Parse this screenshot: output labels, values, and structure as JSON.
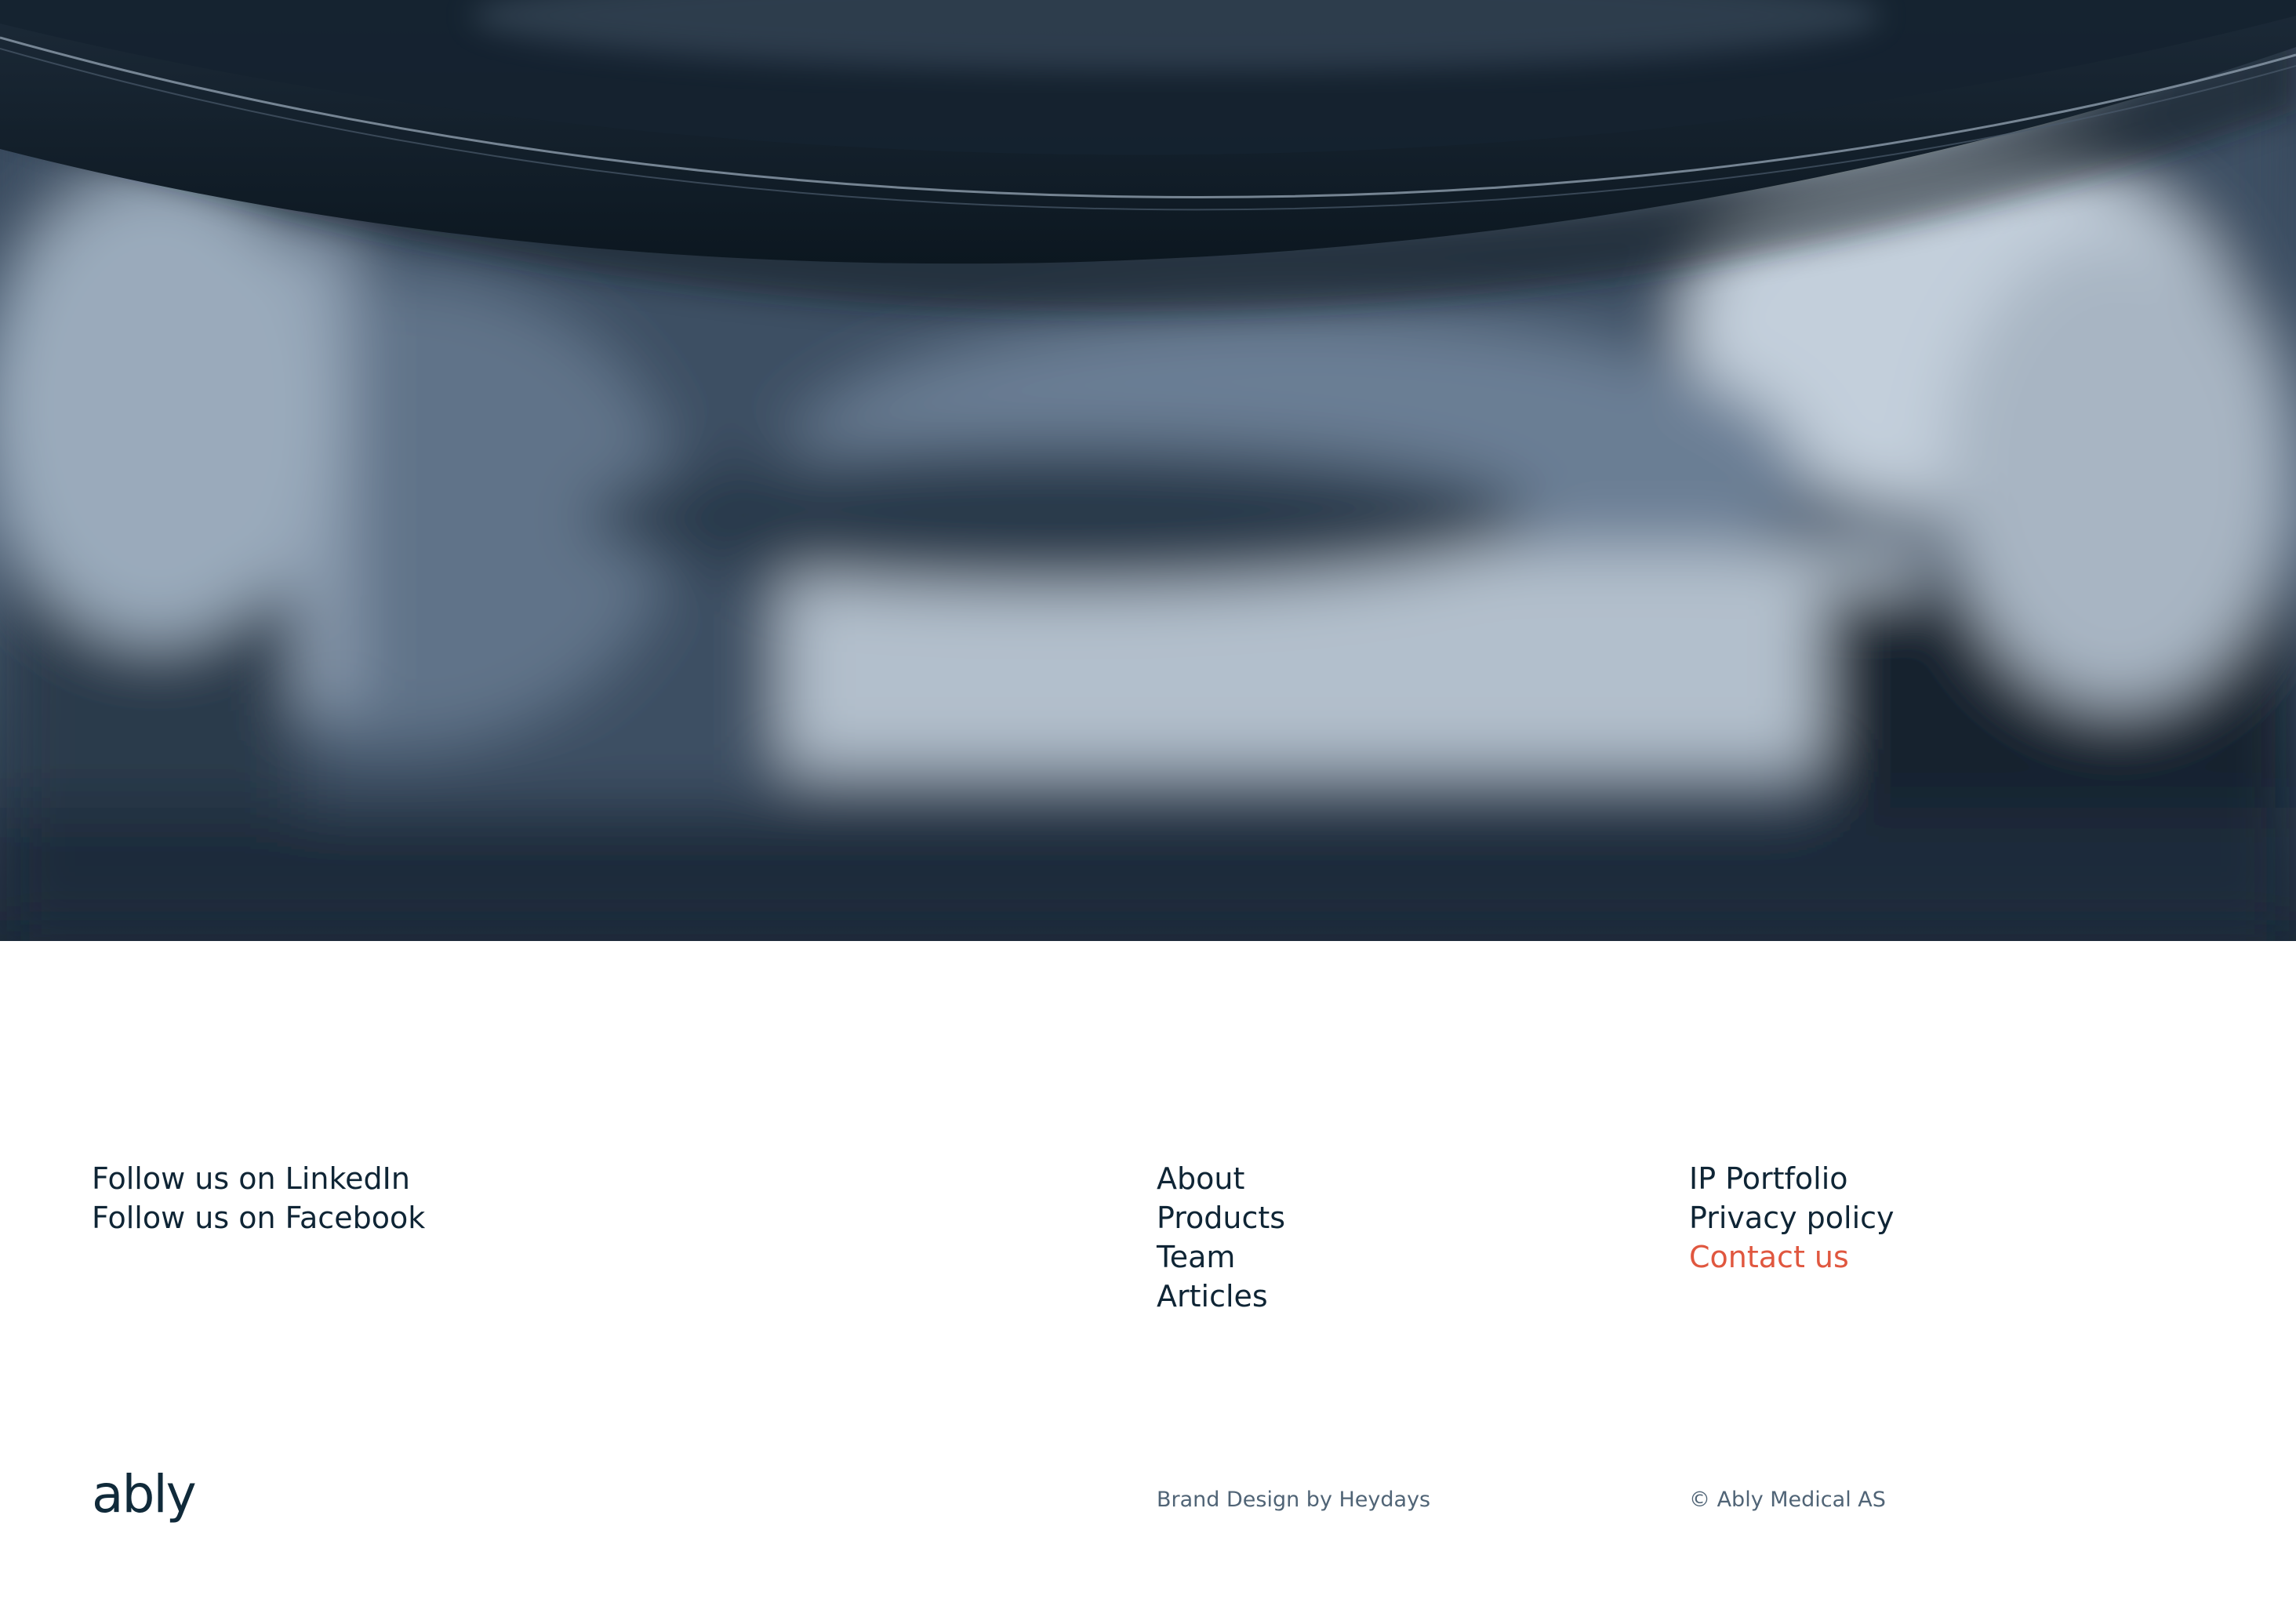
{
  "hero": {
    "colors": {
      "dark": "#0f1a24",
      "mid": "#4a5d73",
      "light": "#b9c6d4"
    }
  },
  "footer": {
    "social_links": [
      {
        "label": "Follow us on LinkedIn"
      },
      {
        "label": "Follow us on Facebook"
      }
    ],
    "nav_links": [
      {
        "label": "About"
      },
      {
        "label": "Products"
      },
      {
        "label": "Team"
      },
      {
        "label": "Articles"
      }
    ],
    "legal_links": [
      {
        "label": "IP Portfolio"
      },
      {
        "label": "Privacy policy"
      },
      {
        "label": "Contact us",
        "accent": true
      }
    ],
    "logo_text": "ably",
    "credit": "Brand Design by Heydays",
    "copyright": "© Ably Medical AS",
    "accent_color": "#e0573f",
    "text_color": "#0f2535"
  }
}
